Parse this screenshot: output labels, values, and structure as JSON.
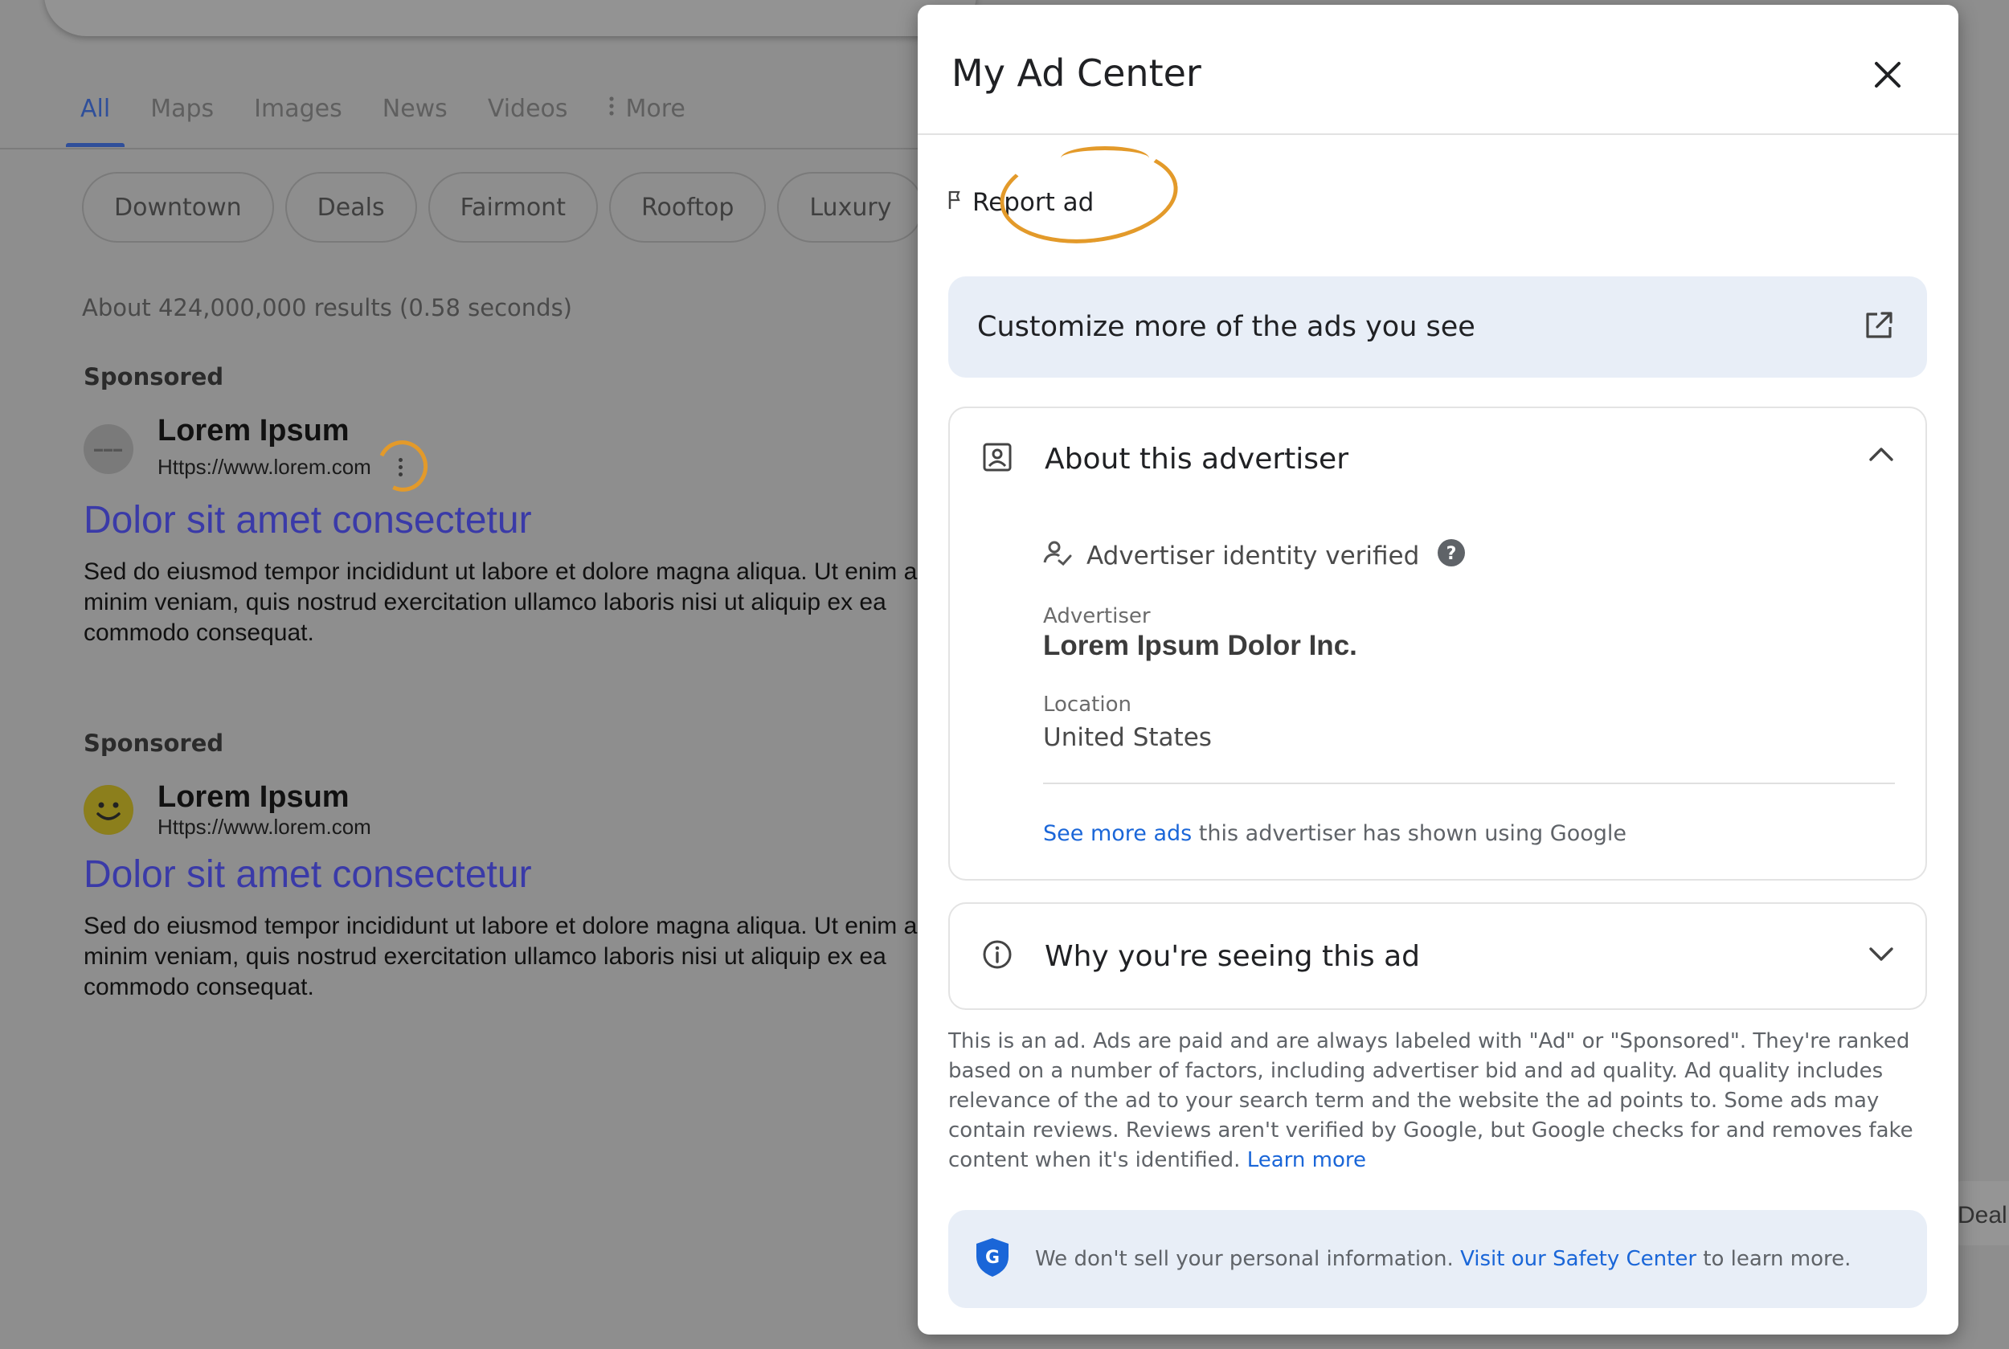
{
  "search": {
    "tabs": [
      {
        "label": "All",
        "active": true
      },
      {
        "label": "Maps"
      },
      {
        "label": "Images"
      },
      {
        "label": "News"
      },
      {
        "label": "Videos"
      },
      {
        "label": "More",
        "icon": "more-vert-icon"
      }
    ],
    "chips": [
      "Downtown",
      "Deals",
      "Fairmont",
      "Rooftop",
      "Luxury"
    ],
    "results_count": "About 424,000,000 results (0.58 seconds)",
    "ads": [
      {
        "sponsored": "Sponsored",
        "name": "Lorem Ipsum",
        "url": "Https://www.lorem.com",
        "title": "Dolor sit amet consectetur",
        "description": "Sed do eiusmod tempor incididunt ut labore et dolore magna aliqua. Ut enim ad minim veniam, quis nostrud exercitation ullamco laboris nisi ut aliquip ex ea commodo consequat."
      },
      {
        "sponsored": "Sponsored",
        "name": "Lorem Ipsum",
        "url": "Https://www.lorem.com",
        "title": "Dolor sit amet consectetur",
        "description": "Sed do eiusmod tempor incididunt ut labore et dolore magna aliqua. Ut enim ad minim veniam, quis nostrud exercitation ullamco laboris nisi ut aliquip ex ea commodo consequat."
      }
    ],
    "right_edge_text": "Deal"
  },
  "dialog": {
    "title": "My Ad Center",
    "report_label": "Report ad",
    "customize_label": "Customize more of the ads you see",
    "advertiser_card": {
      "heading": "About this advertiser",
      "verified_label": "Advertiser identity verified",
      "advertiser_label": "Advertiser",
      "advertiser_value": "Lorem Ipsum Dolor Inc.",
      "location_label": "Location",
      "location_value": "United States",
      "see_more_link": "See more ads",
      "see_more_rest": " this advertiser has shown using Google"
    },
    "why_card": {
      "heading": "Why you're seeing this ad"
    },
    "disclaimer": "This is an ad. Ads are paid and are always labeled with \"Ad\" or \"Sponsored\". They're ranked based on a number of factors, including advertiser bid and ad quality. Ad quality includes relevance of the ad to your search term and the website the ad points to. Some ads may contain reviews. Reviews aren't verified by Google, but Google checks for and removes fake content when it's identified. ",
    "disclaimer_link": "Learn more",
    "safety": {
      "text_before": "We don't sell your personal information. ",
      "link": "Visit our Safety Center",
      "text_after": " to learn more."
    }
  },
  "colors": {
    "accent_link": "#1a66d8",
    "highlight_ring": "#e39a2a",
    "soft_panel": "#e8eef7"
  }
}
